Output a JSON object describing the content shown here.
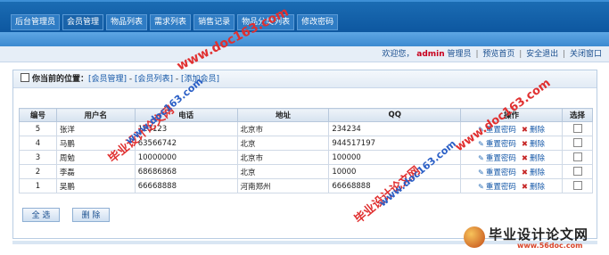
{
  "nav": {
    "tabs": [
      "后台管理员",
      "会员管理",
      "物品列表",
      "需求列表",
      "销售记录",
      "物品分类列表",
      "修改密码"
    ],
    "active_index": 1
  },
  "welcome": {
    "prefix": "欢迎您，",
    "user": "admin",
    "role": "管理员",
    "links": [
      "预览首页",
      "安全退出",
      "关闭窗口"
    ]
  },
  "breadcrumb": {
    "label": "你当前的位置：",
    "crumbs": [
      "[会员管理]",
      "[会员列表]",
      "[添加会员]"
    ]
  },
  "table": {
    "headers": [
      "编号",
      "用户名",
      "电话",
      "地址",
      "QQ",
      "操作",
      "选择"
    ],
    "edit_label": "重置密码",
    "delete_label": "删除",
    "rows": [
      {
        "id": "5",
        "username": "张洋",
        "phone": "123123",
        "address": "北京市",
        "qq": "234234"
      },
      {
        "id": "4",
        "username": "马鹏",
        "phone": "63566742",
        "address": "北京",
        "qq": "944517197"
      },
      {
        "id": "3",
        "username": "周勉",
        "phone": "10000000",
        "address": "北京市",
        "qq": "100000"
      },
      {
        "id": "2",
        "username": "李磊",
        "phone": "68686868",
        "address": "北京",
        "qq": "10000"
      },
      {
        "id": "1",
        "username": "吴鹏",
        "phone": "66668888",
        "address": "河南郑州",
        "qq": "66668888"
      }
    ]
  },
  "buttons": {
    "select_all": "全 选",
    "delete": "删 除"
  },
  "watermark": {
    "cn": "毕业设计论文网",
    "url": "www.doc163.com",
    "logo_name": "毕业设计论文网",
    "logo_url": "www.56doc.com"
  },
  "colors": {
    "nav_bg": "#0d57a0",
    "accent_user": "#c8001e",
    "link": "#1558a8"
  }
}
